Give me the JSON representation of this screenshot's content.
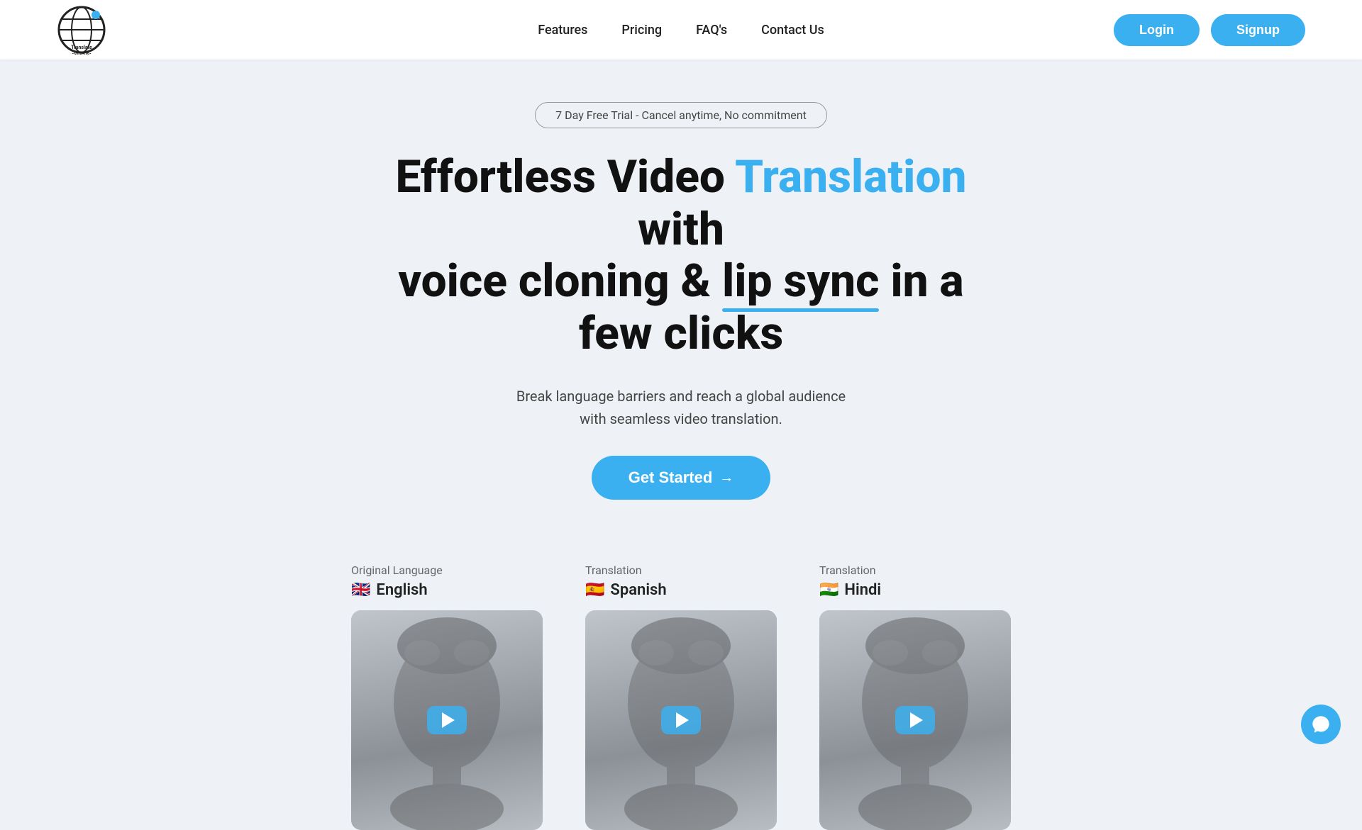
{
  "nav": {
    "logo_alt": "Translate Videos Logo",
    "logo_line1": "Translate",
    "logo_line2": "-Videos-",
    "links": [
      {
        "label": "Features",
        "id": "features"
      },
      {
        "label": "Pricing",
        "id": "pricing"
      },
      {
        "label": "FAQ's",
        "id": "faqs"
      },
      {
        "label": "Contact Us",
        "id": "contact"
      }
    ],
    "login_label": "Login",
    "signup_label": "Signup"
  },
  "hero": {
    "trial_badge": "7 Day Free Trial - Cancel anytime, No commitment",
    "headline_part1": "Effortless Video ",
    "headline_highlight": "Translation",
    "headline_part2": " with",
    "headline_line2_part1": "voice cloning & ",
    "headline_underline": "lip sync",
    "headline_line2_part2": " in a few clicks",
    "subtext_line1": "Break language barriers and reach a global audience",
    "subtext_line2": "with seamless video translation.",
    "cta_label": "Get Started",
    "cta_arrow": "→"
  },
  "demo": {
    "cols": [
      {
        "type_label": "Original Language",
        "flag": "🇬🇧",
        "lang": "English"
      },
      {
        "type_label": "Translation",
        "flag": "🇪🇸",
        "lang": "Spanish"
      },
      {
        "type_label": "Translation",
        "flag": "🇮🇳",
        "lang": "Hindi"
      }
    ]
  },
  "chat": {
    "label": "Chat support"
  }
}
